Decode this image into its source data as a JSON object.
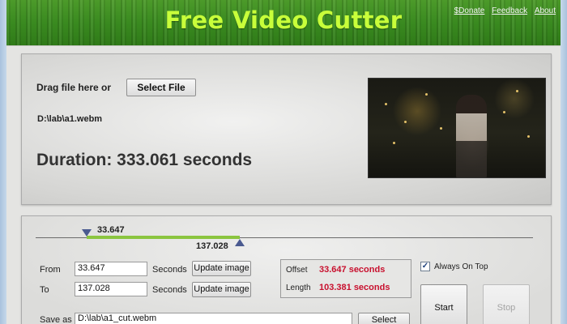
{
  "header": {
    "title": "Free Video Cutter",
    "links": {
      "donate": "$Donate",
      "feedback": "Feedback",
      "about": "About"
    }
  },
  "source": {
    "drag_label": "Drag file here or",
    "select_file_label": "Select File",
    "file_path": "D:\\lab\\a1.webm",
    "duration_text": "Duration: 333.061 seconds"
  },
  "timeline": {
    "start_value": "33.647",
    "end_value": "137.028",
    "duration_seconds": 333.061
  },
  "cut": {
    "from_label": "From",
    "from_value": "33.647",
    "to_label": "To",
    "to_value": "137.028",
    "seconds_label": "Seconds",
    "update_image_label": "Update image",
    "offset_label": "Offset",
    "offset_value": "33.647 seconds",
    "length_label": "Length",
    "length_value": "103.381 seconds",
    "always_on_top_label": "Always On Top",
    "always_on_top_checked": true,
    "start_label": "Start",
    "stop_label": "Stop",
    "save_as_label": "Save as",
    "save_as_value": "D:\\lab\\a1_cut.webm",
    "select_label": "Select"
  },
  "colors": {
    "header_green": "#3a8a20",
    "title_green": "#c8ff3a",
    "range_green": "#8bc53f",
    "value_red": "#c8102e"
  }
}
